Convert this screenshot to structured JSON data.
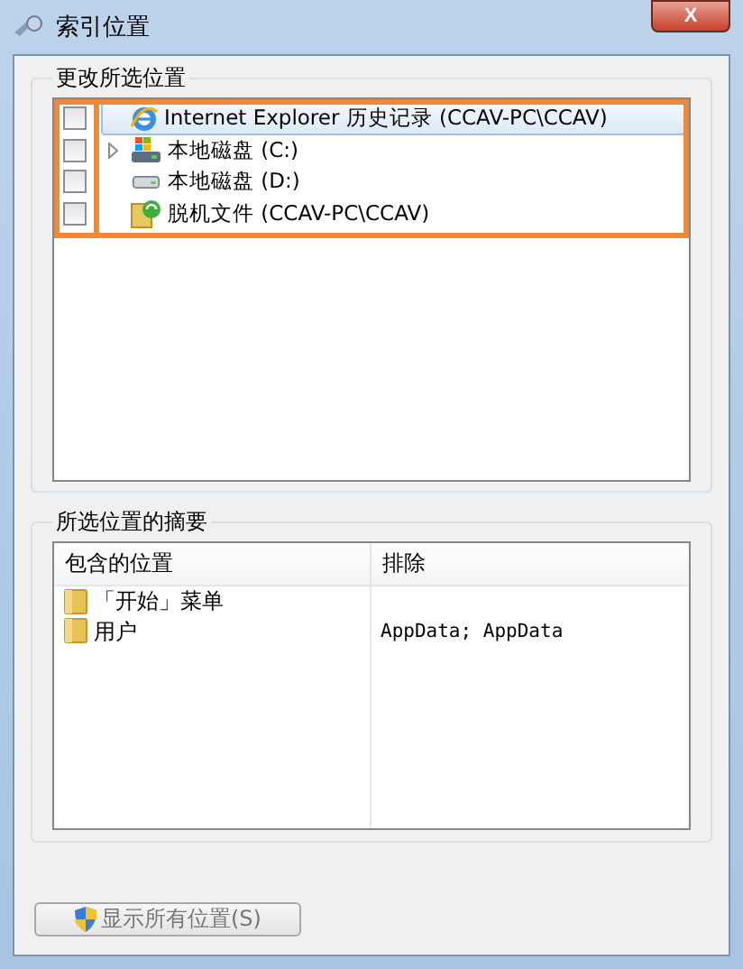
{
  "window": {
    "title": "索引位置",
    "close_label": "X"
  },
  "change_group": {
    "title": "更改所选位置",
    "items": [
      {
        "label": "Internet Explorer 历史记录 (CCAV-PC\\CCAV)",
        "kind": "browser",
        "checked": false,
        "selected": true,
        "expandable": false
      },
      {
        "label": "本地磁盘 (C:)",
        "kind": "system-drive",
        "checked": false,
        "selected": false,
        "expandable": true
      },
      {
        "label": "本地磁盘 (D:)",
        "kind": "drive",
        "checked": false,
        "selected": false,
        "expandable": false
      },
      {
        "label": "脱机文件 (CCAV-PC\\CCAV)",
        "kind": "offline",
        "checked": false,
        "selected": false,
        "expandable": false
      }
    ]
  },
  "summary_group": {
    "title": "所选位置的摘要",
    "columns": [
      "包含的位置",
      "排除"
    ],
    "rows": [
      {
        "location": "「开始」菜单"
      },
      {
        "location": "用户",
        "exclude": "AppData; AppData"
      }
    ]
  },
  "buttons": [
    {
      "label": "显示所有位置(S)"
    }
  ]
}
